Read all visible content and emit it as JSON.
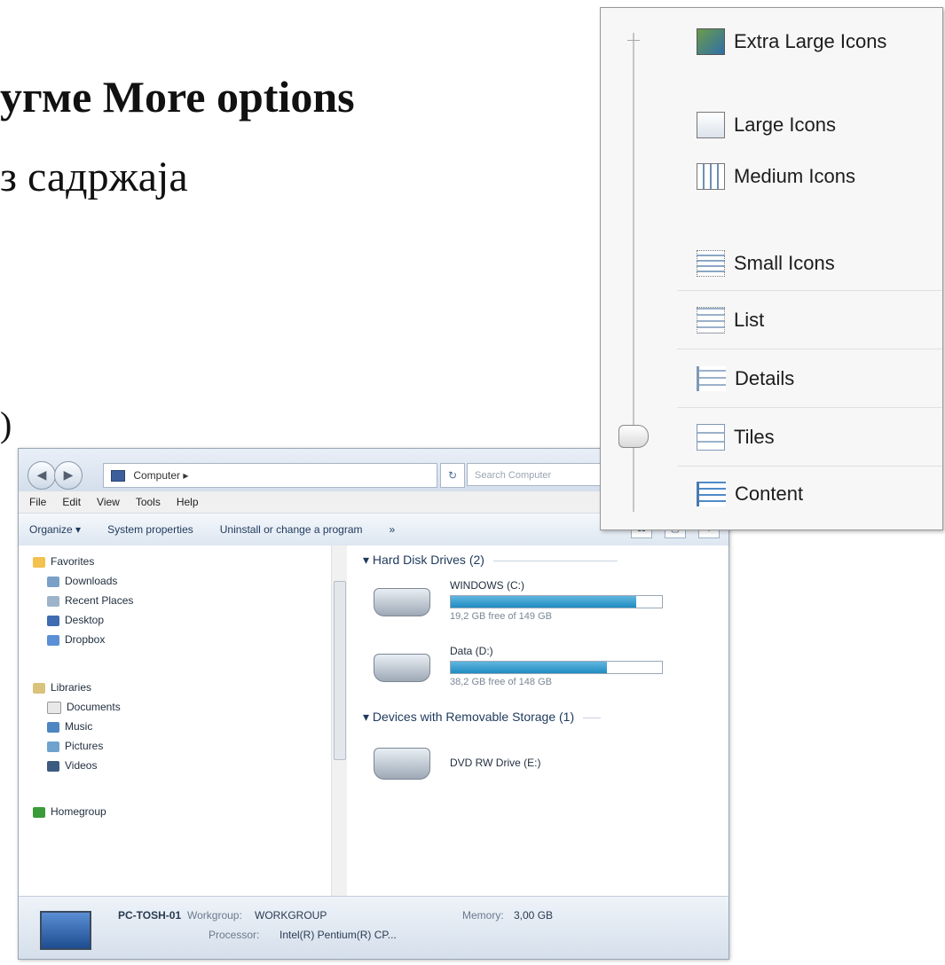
{
  "slide": {
    "line1": "угме More options",
    "line2": "з садржаја",
    "fragment": ")"
  },
  "window": {
    "address": {
      "text": "Computer ▸"
    },
    "search_placeholder": "Search Computer",
    "menubar": [
      "File",
      "Edit",
      "View",
      "Tools",
      "Help"
    ],
    "toolbar": {
      "organize": "Organize ▾",
      "system_properties": "System properties",
      "uninstall": "Uninstall or change a program",
      "more": "»"
    },
    "nav": {
      "favorites": "Favorites",
      "downloads": "Downloads",
      "recent": "Recent Places",
      "desktop": "Desktop",
      "dropbox": "Dropbox",
      "libraries": "Libraries",
      "documents": "Documents",
      "music": "Music",
      "pictures": "Pictures",
      "videos": "Videos",
      "homegroup": "Homegroup"
    },
    "groups": {
      "hdd": "Hard Disk Drives (2)",
      "removable": "Devices with Removable Storage (1)"
    },
    "drives": [
      {
        "name": "WINDOWS (C:)",
        "free": "19,2 GB free of 149 GB",
        "used": 0.88
      },
      {
        "name": "Data (D:)",
        "free": "38,2 GB free of 148 GB",
        "used": 0.74
      }
    ],
    "dvd": "DVD RW Drive (E:)",
    "status": {
      "pc_name": "PC-TOSH-01",
      "workgroup_label": "Workgroup:",
      "workgroup": "WORKGROUP",
      "memory_label": "Memory:",
      "memory": "3,00 GB",
      "processor_label": "Processor:",
      "processor": "Intel(R) Pentium(R) CP..."
    }
  },
  "view_menu": {
    "items": [
      {
        "label": "Extra Large Icons",
        "icon": "extra-large-icons-icon"
      },
      {
        "label": "Large Icons",
        "icon": "large-icons-icon"
      },
      {
        "label": "Medium Icons",
        "icon": "medium-icons-icon"
      },
      {
        "label": "Small Icons",
        "icon": "small-icons-icon"
      },
      {
        "label": "List",
        "icon": "list-icon"
      },
      {
        "label": "Details",
        "icon": "details-icon"
      },
      {
        "label": "Tiles",
        "icon": "tiles-icon"
      },
      {
        "label": "Content",
        "icon": "content-icon"
      }
    ],
    "selected": "Tiles"
  }
}
